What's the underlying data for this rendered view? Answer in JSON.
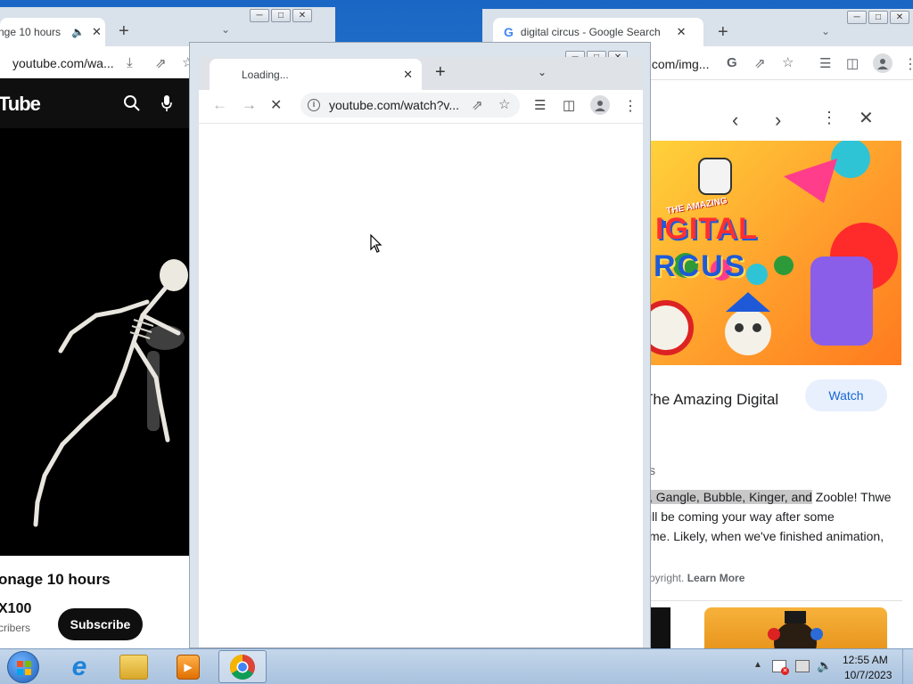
{
  "left_window": {
    "tab_title": "nge 10 hours",
    "url": "youtube.com/wa...",
    "brand": "Tube",
    "video_title": "onage 10 hours",
    "channel": "X100",
    "subscribers": "cribers",
    "subscribe_label": "Subscribe"
  },
  "right_window": {
    "tab_title": "digital circus - Google Search",
    "url": ".com/img...",
    "result_title": "The Amazing Digital",
    "watch_label": "Watch",
    "section_fragment": "s",
    "desc_highlight": ", Gangle, Bubble, Kinger, and",
    "desc_line1_rest": " Zooble! Thwe",
    "desc_line2": "ill be coming your way after some",
    "desc_line3": "me. Likely, when we've finished animation,",
    "copyright_text": "pyright.",
    "learn_more": "Learn More",
    "image_text_top": "THE AMAZING",
    "image_text_mid": "IGITAL",
    "image_text_bot": "RCUS"
  },
  "front_window": {
    "tab_title": "Loading...",
    "url": "youtube.com/watch?v..."
  },
  "taskbar": {
    "time": "12:55 AM",
    "date": "10/7/2023"
  },
  "colors": {
    "subscribe_bg": "#0f0f0f",
    "watch_bg": "#e8f0fe",
    "highlight": "#c8c8c8"
  }
}
